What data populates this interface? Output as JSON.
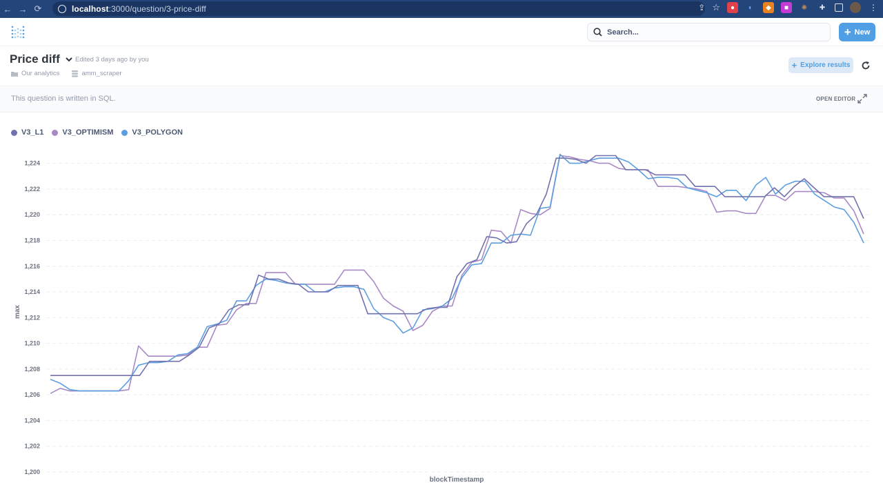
{
  "browser": {
    "url_host": "localhost",
    "url_path": ":3000/question/3-price-diff"
  },
  "header": {
    "search_placeholder": "Search...",
    "new_label": "New"
  },
  "question": {
    "title": "Price diff",
    "edited": "Edited 3 days ago by you",
    "collection": "Our analytics",
    "database": "amm_scraper",
    "explore_label": "Explore results"
  },
  "sql_notice": {
    "text": "This question is written in SQL.",
    "open_editor": "OPEN EDITOR"
  },
  "colors": {
    "accent": "#509ee3",
    "chrome": "#24457a"
  },
  "chart_data": {
    "type": "line",
    "xlabel": "blockTimestamp",
    "ylabel": "max",
    "ylim": [
      1200,
      1225
    ],
    "yticks": [
      1200,
      1202,
      1204,
      1206,
      1208,
      1210,
      1212,
      1214,
      1216,
      1218,
      1220,
      1222,
      1224
    ],
    "ytick_labels": [
      "1,200",
      "1,202",
      "1,204",
      "1,206",
      "1,208",
      "1,210",
      "1,212",
      "1,214",
      "1,216",
      "1,218",
      "1,220",
      "1,222",
      "1,224"
    ],
    "grid": true,
    "legend": "top-left",
    "series": [
      {
        "name": "V3_L1",
        "color": "#7172ad",
        "values": [
          1207.5,
          1207.5,
          1207.5,
          1207.5,
          1207.5,
          1207.5,
          1207.5,
          1207.5,
          1207.5,
          1207.5,
          1208.6,
          1208.6,
          1208.6,
          1208.6,
          1209.1,
          1209.7,
          1211.2,
          1211.5,
          1212.6,
          1213.0,
          1213.0,
          1215.3,
          1215.0,
          1215.0,
          1214.7,
          1214.6,
          1214.0,
          1214.0,
          1214.0,
          1214.5,
          1214.5,
          1214.5,
          1212.3,
          1212.3,
          1212.3,
          1212.3,
          1212.3,
          1212.3,
          1212.7,
          1212.8,
          1212.8,
          1215.2,
          1216.2,
          1216.5,
          1218.3,
          1218.2,
          1217.8,
          1217.9,
          1219.3,
          1220.0,
          1221.6,
          1224.4,
          1224.4,
          1224.3,
          1224.0,
          1224.6,
          1224.6,
          1224.6,
          1223.5,
          1223.5,
          1223.5,
          1223.1,
          1223.1,
          1223.1,
          1223.1,
          1222.2,
          1222.2,
          1222.2,
          1221.4,
          1221.4,
          1221.4,
          1221.4,
          1221.4,
          1222.1,
          1221.4,
          1222.2,
          1222.8,
          1222.1,
          1221.4,
          1221.4,
          1221.4,
          1221.4,
          1219.7
        ]
      },
      {
        "name": "V3_OPTIMISM",
        "color": "#a989c5",
        "values": [
          1206.1,
          1206.5,
          1206.3,
          1206.3,
          1206.3,
          1206.3,
          1206.3,
          1206.3,
          1206.4,
          1209.8,
          1209.0,
          1209.0,
          1209.0,
          1209.0,
          1209.1,
          1209.7,
          1209.7,
          1211.4,
          1211.5,
          1212.6,
          1213.1,
          1213.1,
          1215.5,
          1215.5,
          1215.5,
          1214.6,
          1214.6,
          1214.6,
          1214.6,
          1214.6,
          1215.7,
          1215.7,
          1215.7,
          1214.8,
          1213.5,
          1212.9,
          1212.5,
          1211.0,
          1211.4,
          1212.5,
          1212.9,
          1212.9,
          1215.3,
          1216.3,
          1216.5,
          1218.8,
          1218.7,
          1217.8,
          1220.4,
          1220.1,
          1220.0,
          1220.5,
          1224.6,
          1224.5,
          1224.3,
          1224.2,
          1224.0,
          1224.0,
          1223.6,
          1223.5,
          1223.5,
          1223.5,
          1222.2,
          1222.2,
          1222.2,
          1222.1,
          1222.0,
          1221.8,
          1220.2,
          1220.3,
          1220.3,
          1220.1,
          1220.1,
          1221.5,
          1221.5,
          1221.1,
          1221.8,
          1221.8,
          1221.8,
          1221.7,
          1221.3,
          1221.3,
          1220.3,
          1218.5
        ]
      },
      {
        "name": "V3_POLYGON",
        "color": "#5b9fe0",
        "values": [
          1207.2,
          1206.9,
          1206.4,
          1206.3,
          1206.3,
          1206.3,
          1206.3,
          1206.3,
          1207.1,
          1208.3,
          1208.5,
          1208.5,
          1208.6,
          1209.1,
          1209.2,
          1209.7,
          1211.3,
          1211.5,
          1211.8,
          1213.3,
          1213.3,
          1214.5,
          1215.0,
          1214.9,
          1214.7,
          1214.6,
          1214.6,
          1214.0,
          1214.0,
          1214.3,
          1214.4,
          1214.4,
          1214.2,
          1212.7,
          1212.0,
          1211.7,
          1210.8,
          1211.2,
          1212.6,
          1212.7,
          1212.9,
          1213.5,
          1215.1,
          1216.1,
          1216.2,
          1217.8,
          1217.8,
          1218.4,
          1218.5,
          1218.4,
          1220.5,
          1220.6,
          1224.7,
          1224.0,
          1224.0,
          1224.2,
          1224.4,
          1224.4,
          1224.4,
          1224.1,
          1223.5,
          1222.8,
          1222.9,
          1222.9,
          1222.8,
          1222.1,
          1221.9,
          1221.7,
          1221.4,
          1221.9,
          1221.9,
          1221.1,
          1222.3,
          1222.9,
          1221.6,
          1222.3,
          1222.6,
          1222.6,
          1221.6,
          1221.1,
          1220.6,
          1220.4,
          1219.4,
          1217.8
        ]
      }
    ]
  }
}
